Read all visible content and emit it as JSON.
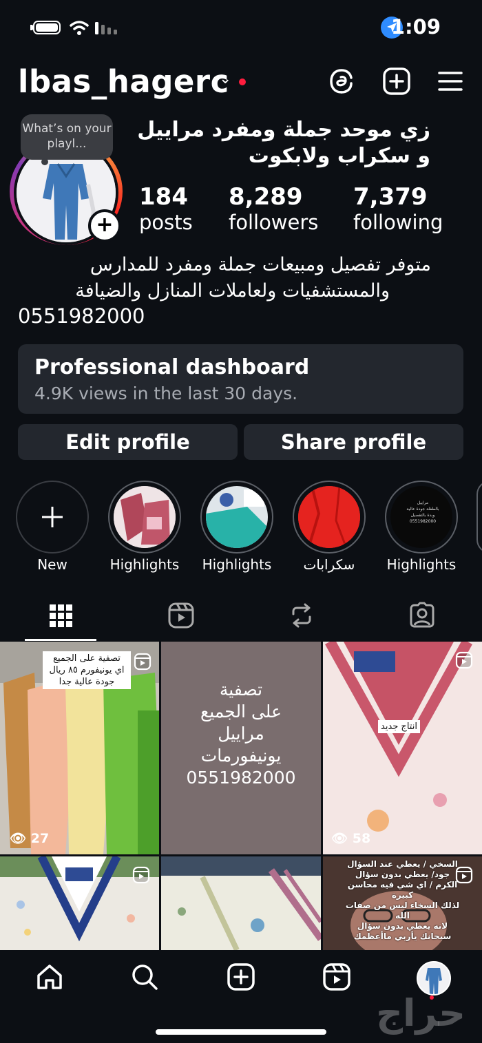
{
  "status_bar": {
    "time": "1:09"
  },
  "header": {
    "username": "lbas_hagerc"
  },
  "profile": {
    "bubble_text": "What’s on your playl...",
    "display_name": "زي موحد جملة ومفرد مراييل و سكراب ولابكوت",
    "stats": [
      {
        "value": "184",
        "label": "posts"
      },
      {
        "value": "8,289",
        "label": "followers"
      },
      {
        "value": "7,379",
        "label": "following"
      }
    ],
    "bio_line1": "متوفر تفصيل ومبيعات جملة ومفرد للمدارس",
    "bio_line2": "والمستشفيات ولعاملات المنازل والضيافة",
    "phone": "0551982000"
  },
  "dashboard": {
    "title": "Professional dashboard",
    "subtitle": "4.9K views in the last 30 days."
  },
  "buttons": {
    "edit": "Edit profile",
    "share": "Share profile"
  },
  "highlights": [
    {
      "label": "New"
    },
    {
      "label": "Highlights"
    },
    {
      "label": "Highlights"
    },
    {
      "label": "سكرابات"
    },
    {
      "label": "Highlights"
    }
  ],
  "highlight_story_text": [
    "مراييل",
    "بالطفلة جودة عالية",
    "وبدة بالتفصيل",
    "0551982000"
  ],
  "grid": {
    "post1_caption": [
      "تصفية على الجميع",
      "اي يونيفورم ٨٥ ريال",
      "جودة عالية جدا"
    ],
    "post1_views": "27",
    "post2_text": [
      "تصفية",
      "على الجميع",
      "مراييل",
      "يونيفورمات",
      "0551982000"
    ],
    "post3_tag": "انتاج جديد",
    "post3_views": "58",
    "post6_text": [
      "السخي / يعطي عند السؤال",
      "جود/ يعطي بدون سؤال",
      "الكرم / اي شي فيه محاسن",
      "كبيرة",
      "لذلك السخاء ليس من صفات",
      "الله",
      "لانه يعطي بدون سؤال",
      "سبحانك يأربي ماأعظمك"
    ]
  },
  "watermark": "حراج",
  "colors": {
    "background": "#0c0f14",
    "card": "#23272e",
    "accent_red": "#ff1d3e",
    "location_blue": "#2f8cff"
  }
}
